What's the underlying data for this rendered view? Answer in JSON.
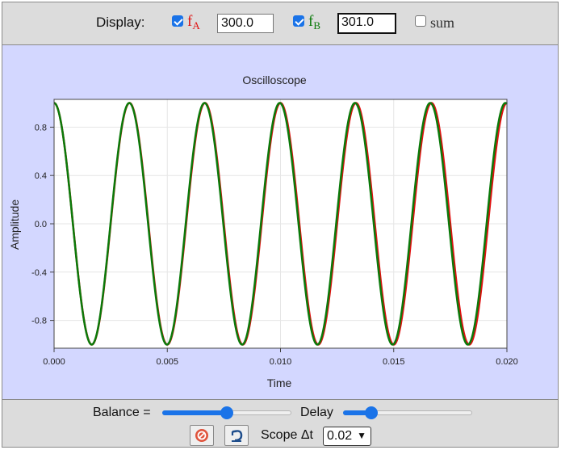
{
  "topbar": {
    "display_label": "Display:",
    "fa": {
      "checked": true,
      "symbol": "f",
      "sub": "A",
      "color": "#e01010",
      "value": "300.0"
    },
    "fb": {
      "checked": true,
      "symbol": "f",
      "sub": "B",
      "color": "#0a7a0a",
      "value": "301.0"
    },
    "sum": {
      "checked": false,
      "label": "sum"
    }
  },
  "scope": {
    "background": "#d3d7ff"
  },
  "chart_data": {
    "type": "line",
    "title": "Oscilloscope",
    "xlabel": "Time",
    "ylabel": "Amplitude",
    "xlim": [
      0,
      0.02
    ],
    "ylim": [
      -1.03,
      1.03
    ],
    "x_ticks": [
      "0.000",
      "0.005",
      "0.010",
      "0.015",
      "0.020"
    ],
    "y_ticks": [
      "0.8",
      "0.4",
      "0.0",
      "-0.4",
      "-0.8"
    ],
    "grid": true,
    "series": [
      {
        "function": "sin",
        "frequency_hz": 300.0,
        "amplitude": 1.0,
        "phase_cycles": 0.25,
        "color": "#e01010"
      },
      {
        "function": "sin",
        "frequency_hz": 301.0,
        "amplitude": 1.0,
        "phase_cycles": 0.25,
        "color": "#0a7a0a"
      }
    ]
  },
  "bottombar": {
    "balance_label": "Balance =",
    "balance_value": 0.5,
    "delay_label": "Delay",
    "delay_value": 0.22,
    "reset_icon": "stop-icon",
    "undo_icon": "undo-icon",
    "scope_dt_label": "Scope Δt",
    "scope_dt_value": "0.02"
  }
}
